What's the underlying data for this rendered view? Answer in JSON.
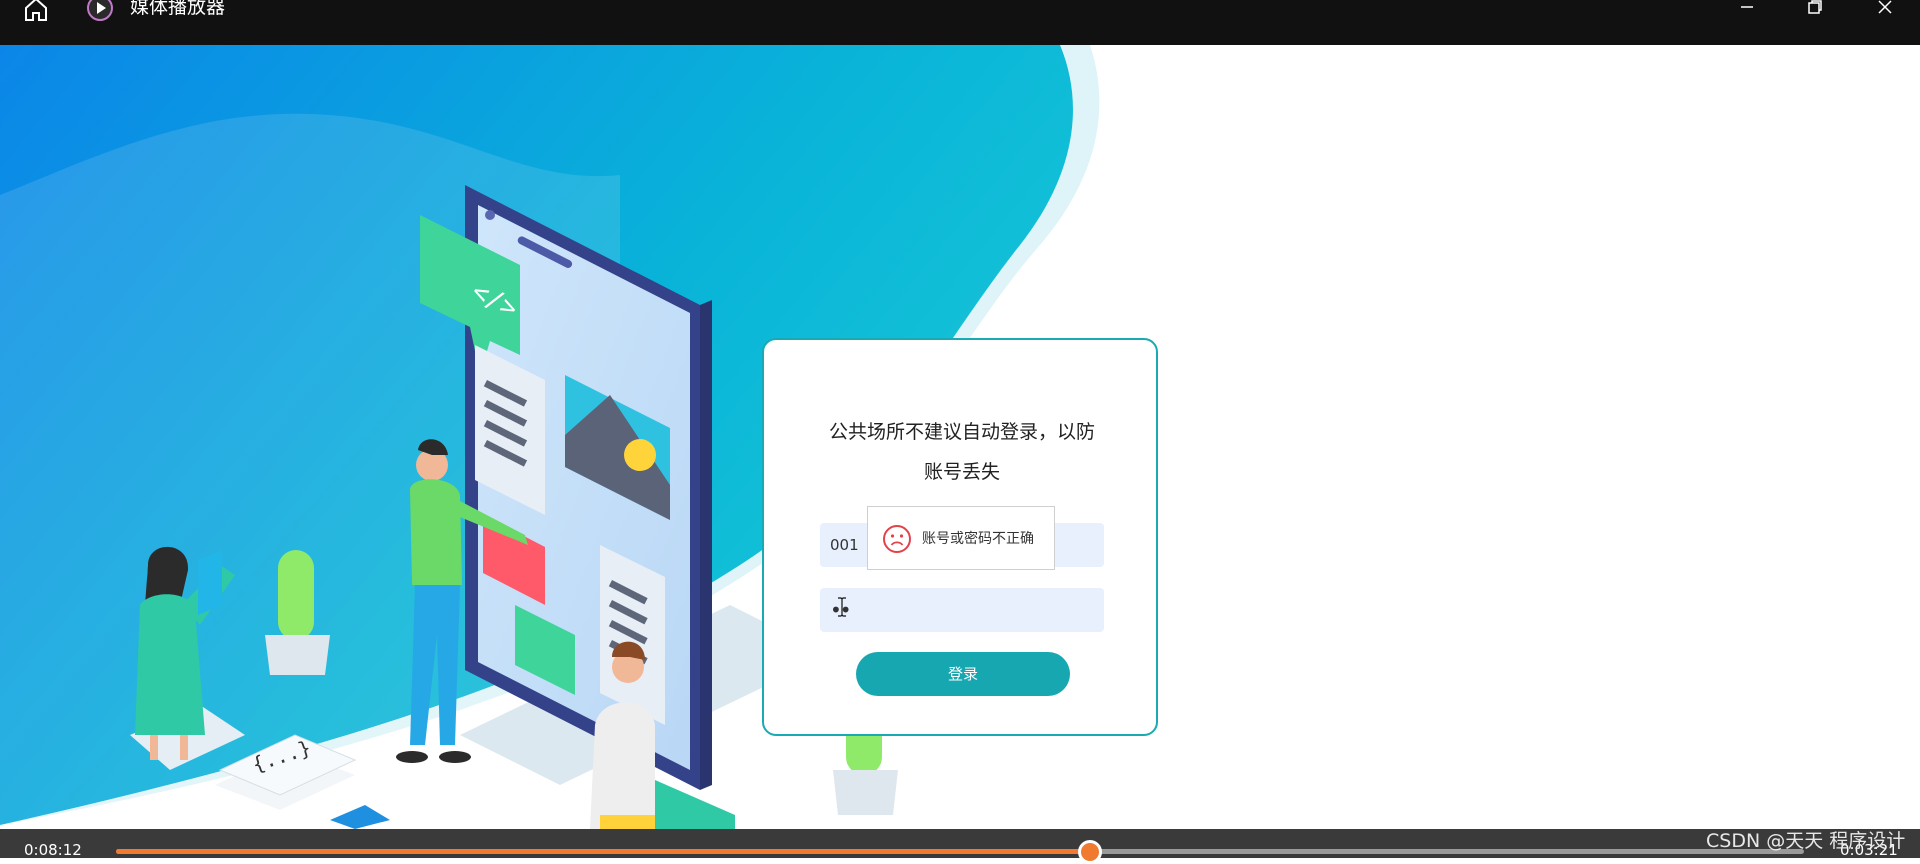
{
  "window": {
    "title": "媒体播放器",
    "buttons": [
      "minimize-icon",
      "maximize-icon",
      "close-icon"
    ]
  },
  "login": {
    "notice": "公共场所不建议自动登录，以防账号丢失",
    "username_value": "001",
    "password_value": "••",
    "submit_label": "登录",
    "error_toast": "账号或密码不正确",
    "error_icon": "sad-face-icon"
  },
  "player": {
    "current_time": "0:08:12",
    "total_time": "0:03:21",
    "progress": 0.577
  },
  "watermark": "CSDN @天天 程序设计",
  "colors": {
    "accent": "#17a7b1",
    "progress": "#f07a30",
    "titlebar": "#111111",
    "card_border": "#19aab3",
    "input_bg": "#e8f0fd"
  }
}
